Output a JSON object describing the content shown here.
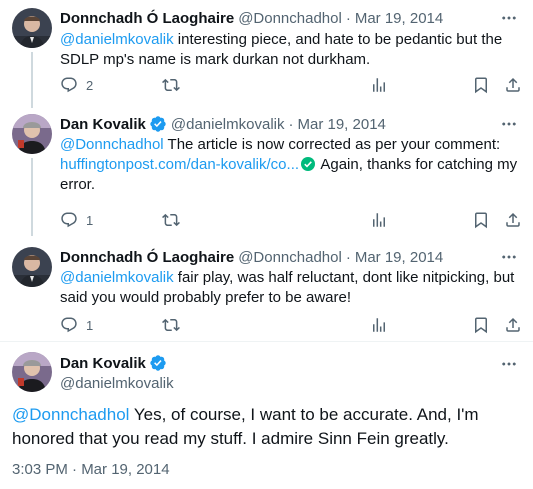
{
  "replies": [
    {
      "name": "Donnchadh Ó Laoghaire",
      "handle": "@Donnchadhol",
      "separator": "·",
      "date": "Mar 19, 2014",
      "verified": false,
      "text": {
        "mention": "@danielmkovalik",
        "body": " interesting piece, and hate to be pedantic but the SDLP mp's name is mark durkan not durkham."
      },
      "reply_count": "2",
      "retweet_count": "",
      "like_count": ""
    },
    {
      "name": "Dan Kovalik",
      "handle": "@danielmkovalik",
      "separator": "·",
      "date": "Mar 19, 2014",
      "verified": true,
      "text": {
        "mention": "@Donnchadhol",
        "body1": " The article is now corrected as per your comment: ",
        "link": "huffingtonpost.com/dan-kovalik/co...",
        "body2": " Again, thanks for catching my error."
      },
      "reply_count": "1",
      "retweet_count": "",
      "like_count": ""
    },
    {
      "name": "Donnchadh Ó Laoghaire",
      "handle": "@Donnchadhol",
      "separator": "·",
      "date": "Mar 19, 2014",
      "verified": false,
      "text": {
        "mention": "@danielmkovalik",
        "body": " fair play, was half reluctant, dont like nitpicking, but said you would probably prefer to be aware!"
      },
      "reply_count": "1",
      "retweet_count": "",
      "like_count": ""
    }
  ],
  "main": {
    "name": "Dan Kovalik",
    "handle": "@danielmkovalik",
    "verified": true,
    "mention": "@Donnchadhol",
    "body": " Yes, of course, I want to be accurate.  And, I'm honored that you read my stuff.  I admire Sinn Fein greatly.",
    "timestamp": "3:03 PM · Mar 19, 2014"
  },
  "icons": {
    "more": "more-horizontal-icon",
    "reply": "reply-icon",
    "retweet": "retweet-icon",
    "like": "heart-icon",
    "views": "views-icon",
    "bookmark": "bookmark-icon",
    "share": "share-icon",
    "verified": "verified-badge-icon"
  },
  "colors": {
    "accent": "#1d9bf0",
    "secondary_text": "#536471",
    "thread_line": "#cfd9de",
    "divider": "#eff3f4",
    "verified_check": "#1d9bf0",
    "inline_check": "#00ba7c"
  }
}
